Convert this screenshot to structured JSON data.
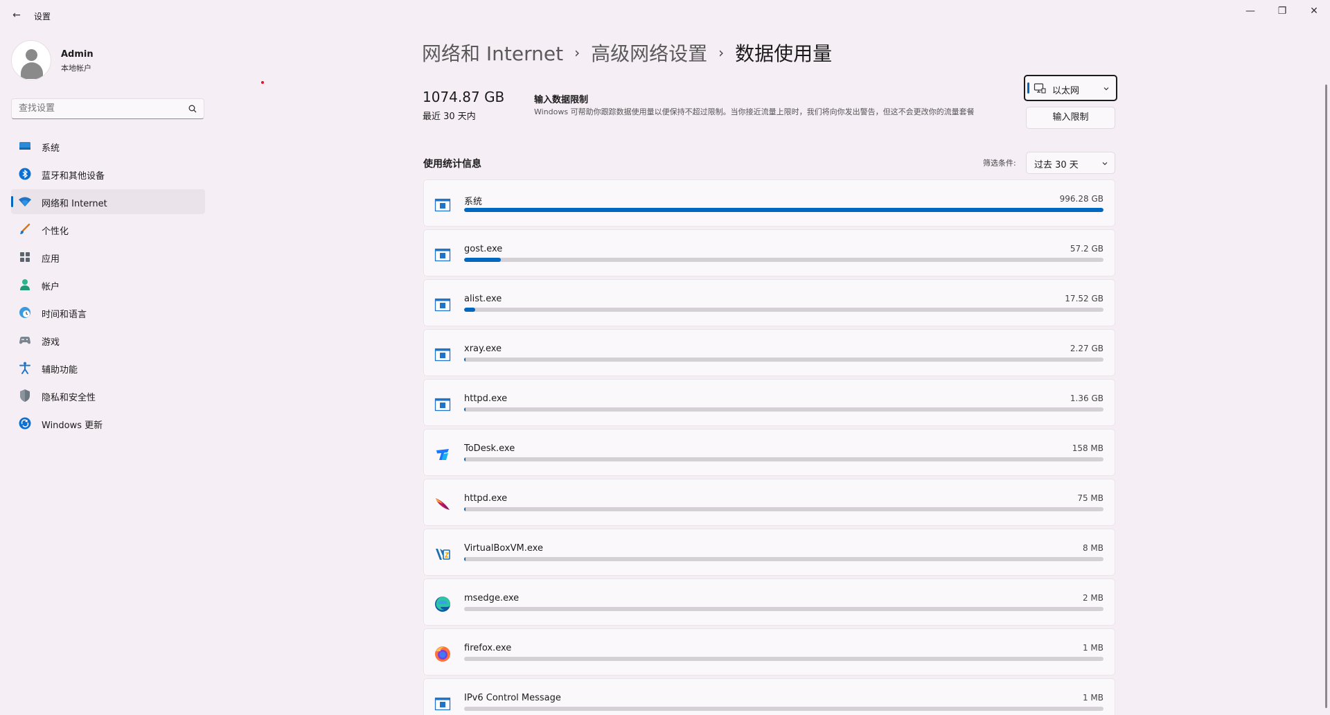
{
  "window": {
    "title": "设置",
    "back_glyph": "←",
    "minimize_glyph": "—",
    "maximize_glyph": "❐",
    "close_glyph": "✕"
  },
  "profile": {
    "name": "Admin",
    "account_type": "本地帐户"
  },
  "search": {
    "placeholder": "查找设置"
  },
  "sidebar": {
    "items": [
      {
        "label": "系统",
        "icon": "system-icon",
        "active": false
      },
      {
        "label": "蓝牙和其他设备",
        "icon": "bluetooth-icon",
        "active": false
      },
      {
        "label": "网络和 Internet",
        "icon": "network-icon",
        "active": true
      },
      {
        "label": "个性化",
        "icon": "brush-icon",
        "active": false
      },
      {
        "label": "应用",
        "icon": "apps-icon",
        "active": false
      },
      {
        "label": "帐户",
        "icon": "account-icon",
        "active": false
      },
      {
        "label": "时间和语言",
        "icon": "globe-clock-icon",
        "active": false
      },
      {
        "label": "游戏",
        "icon": "gamepad-icon",
        "active": false
      },
      {
        "label": "辅助功能",
        "icon": "accessibility-icon",
        "active": false
      },
      {
        "label": "隐私和安全性",
        "icon": "shield-icon",
        "active": false
      },
      {
        "label": "Windows 更新",
        "icon": "update-icon",
        "active": false
      }
    ]
  },
  "breadcrumb": {
    "items": [
      "网络和 Internet",
      "高级网络设置",
      "数据使用量"
    ],
    "separator": "›"
  },
  "summary": {
    "total": "1074.87 GB",
    "period": "最近 30 天内"
  },
  "data_limit": {
    "title": "输入数据限制",
    "description": "Windows 可帮助你跟踪数据使用量以便保持不超过限制。当你接近流量上限时，我们将向你发出警告，但这不会更改你的流量套餐",
    "button_label": "输入限制"
  },
  "connection": {
    "selected": "以太网"
  },
  "stats": {
    "title": "使用统计信息",
    "filter_label": "筛选条件:",
    "filter_value": "过去 30 天"
  },
  "apps": [
    {
      "name": "系统",
      "usage": "996.28 GB",
      "fraction": 1.0,
      "icon": "app-window-icon"
    },
    {
      "name": "gost.exe",
      "usage": "57.2 GB",
      "fraction": 0.0574,
      "icon": "app-window-icon"
    },
    {
      "name": "alist.exe",
      "usage": "17.52 GB",
      "fraction": 0.0176,
      "icon": "app-window-icon"
    },
    {
      "name": "xray.exe",
      "usage": "2.27 GB",
      "fraction": 0.0023,
      "icon": "app-window-icon"
    },
    {
      "name": "httpd.exe",
      "usage": "1.36 GB",
      "fraction": 0.0014,
      "icon": "app-window-icon"
    },
    {
      "name": "ToDesk.exe",
      "usage": "158 MB",
      "fraction": 0.00016,
      "icon": "todesk-icon"
    },
    {
      "name": "httpd.exe",
      "usage": "75 MB",
      "fraction": 8e-05,
      "icon": "apache-feather-icon"
    },
    {
      "name": "VirtualBoxVM.exe",
      "usage": "8 MB",
      "fraction": 1e-05,
      "icon": "virtualbox-icon"
    },
    {
      "name": "msedge.exe",
      "usage": "2 MB",
      "fraction": 0.0,
      "icon": "edge-icon"
    },
    {
      "name": "firefox.exe",
      "usage": "1 MB",
      "fraction": 0.0,
      "icon": "firefox-icon"
    },
    {
      "name": "IPv6 Control Message",
      "usage": "1 MB",
      "fraction": 0.0,
      "icon": "app-window-icon"
    }
  ],
  "colors": {
    "accent": "#0067c0",
    "background": "#f5eef5",
    "card": "#fbf8fb",
    "track": "#d5d0d5"
  }
}
